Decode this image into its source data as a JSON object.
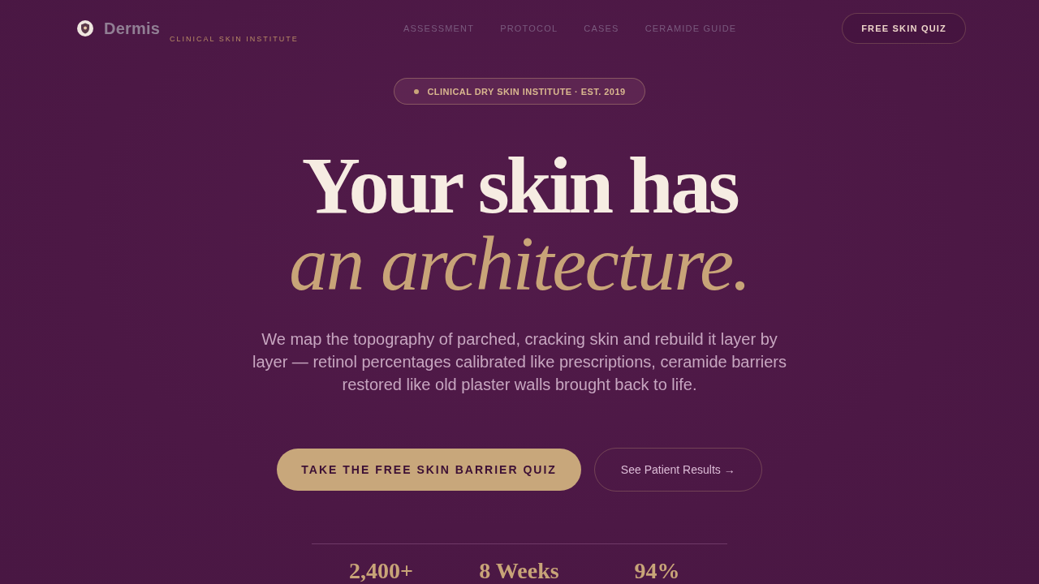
{
  "brand": {
    "name": "Dermis",
    "tagline": "CLINICAL SKIN INSTITUTE"
  },
  "nav": {
    "links": [
      "ASSESSMENT",
      "PROTOCOL",
      "CASES",
      "CERAMIDE GUIDE"
    ],
    "cta": "FREE SKIN QUIZ"
  },
  "hero": {
    "badge": "CLINICAL DRY SKIN INSTITUTE · EST. 2019",
    "headline": "Your skin has",
    "headline_accent": "an architecture.",
    "description": "We map the topography of parched, cracking skin and rebuild it layer by layer — retinol percentages calibrated like prescriptions, ceramide barriers restored like old plaster walls brought back to life.",
    "primary_button": "TAKE THE FREE SKIN BARRIER QUIZ",
    "secondary_button": "See Patient Results →"
  },
  "stats": [
    {
      "value": "2,400+"
    },
    {
      "value": "8 Weeks"
    },
    {
      "value": "94%"
    }
  ]
}
